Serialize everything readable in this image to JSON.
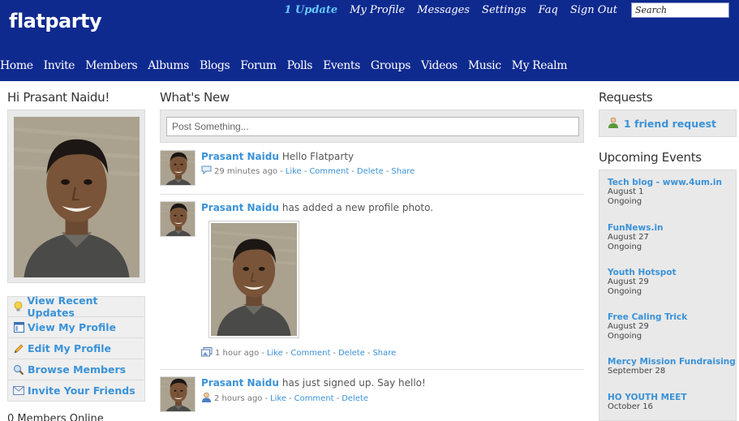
{
  "header": {
    "logo": "flatparty",
    "toplinks": [
      {
        "label": "1 Update",
        "name": "updates-link",
        "accent": true
      },
      {
        "label": "My Profile",
        "name": "my-profile-link"
      },
      {
        "label": "Messages",
        "name": "messages-link"
      },
      {
        "label": "Settings",
        "name": "settings-link"
      },
      {
        "label": "Faq",
        "name": "faq-link"
      },
      {
        "label": "Sign Out",
        "name": "sign-out-link"
      }
    ],
    "search_placeholder": "Search",
    "nav": [
      "Home",
      "Invite",
      "Members",
      "Albums",
      "Blogs",
      "Forum",
      "Polls",
      "Events",
      "Groups",
      "Videos",
      "Music",
      "My Realm"
    ]
  },
  "left": {
    "greeting": "Hi Prasant Naidu!",
    "quicklinks": [
      {
        "label": "View Recent Updates",
        "icon": "lightbulb-icon"
      },
      {
        "label": "View My Profile",
        "icon": "profile-page-icon"
      },
      {
        "label": "Edit My Profile",
        "icon": "pencil-icon"
      },
      {
        "label": "Browse Members",
        "icon": "magnifier-icon"
      },
      {
        "label": "Invite Your Friends",
        "icon": "envelope-icon"
      }
    ],
    "members_online": "0 Members Online"
  },
  "center": {
    "title": "What's New",
    "post_placeholder": "Post Something...",
    "feed": [
      {
        "name": "Prasant Naidu",
        "text": "Hello Flatparty",
        "time": "29 minutes ago",
        "icon": "speech-bubble-icon",
        "actions": [
          "Like",
          "Comment",
          "Delete",
          "Share"
        ]
      },
      {
        "name": "Prasant Naidu",
        "text": "has added a new profile photo.",
        "time": "1 hour ago",
        "icon": "photo-album-icon",
        "actions": [
          "Like",
          "Comment",
          "Delete",
          "Share"
        ]
      },
      {
        "name": "Prasant Naidu",
        "text": "has just signed up. Say hello!",
        "time": "2 hours ago",
        "icon": "user-icon",
        "actions": [
          "Like",
          "Comment",
          "Delete"
        ]
      }
    ]
  },
  "right": {
    "requests_title": "Requests",
    "request_label": "1 friend request",
    "events_title": "Upcoming Events",
    "events": [
      {
        "name": "Tech blog - www.4um.in",
        "date": "August 1",
        "status": "Ongoing"
      },
      {
        "name": "FunNews.in",
        "date": "August 27",
        "status": "Ongoing"
      },
      {
        "name": "Youth Hotspot",
        "date": "August 29",
        "status": "Ongoing"
      },
      {
        "name": "Free Caling Trick",
        "date": "August 29",
        "status": "Ongoing"
      },
      {
        "name": "Mercy Mission Fundraising",
        "date": "September 28",
        "status": ""
      },
      {
        "name": "HO YOUTH MEET",
        "date": "October 16",
        "status": ""
      }
    ]
  },
  "colors": {
    "header_bg": "#0f2a8f",
    "link_blue": "#3a92d8",
    "update_accent": "#66c8ff",
    "panel_bg": "#e9e9e9"
  }
}
